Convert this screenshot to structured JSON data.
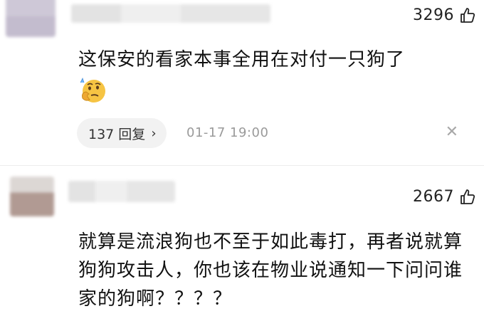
{
  "comments": [
    {
      "likes": "3296",
      "text": "这保安的看家本事全用在对付一只狗了",
      "emoji": "thinking-face-emoji",
      "reply_label": "137 回复",
      "reply_chevron": "›",
      "timestamp": "01-17 19:00",
      "close_label": "✕"
    },
    {
      "likes": "2667",
      "text": "就算是流浪狗也不至于如此毒打，再者说就算狗狗攻击人，你也该在物业说通知一下问问谁家的狗啊？？？？"
    }
  ],
  "icons": {
    "like": "thumbs-up-icon",
    "close": "close-icon",
    "chevron": "chevron-right-icon"
  },
  "colors": {
    "text": "#111111",
    "muted": "#9a9a9a",
    "pill_bg": "#f2f2f2"
  }
}
